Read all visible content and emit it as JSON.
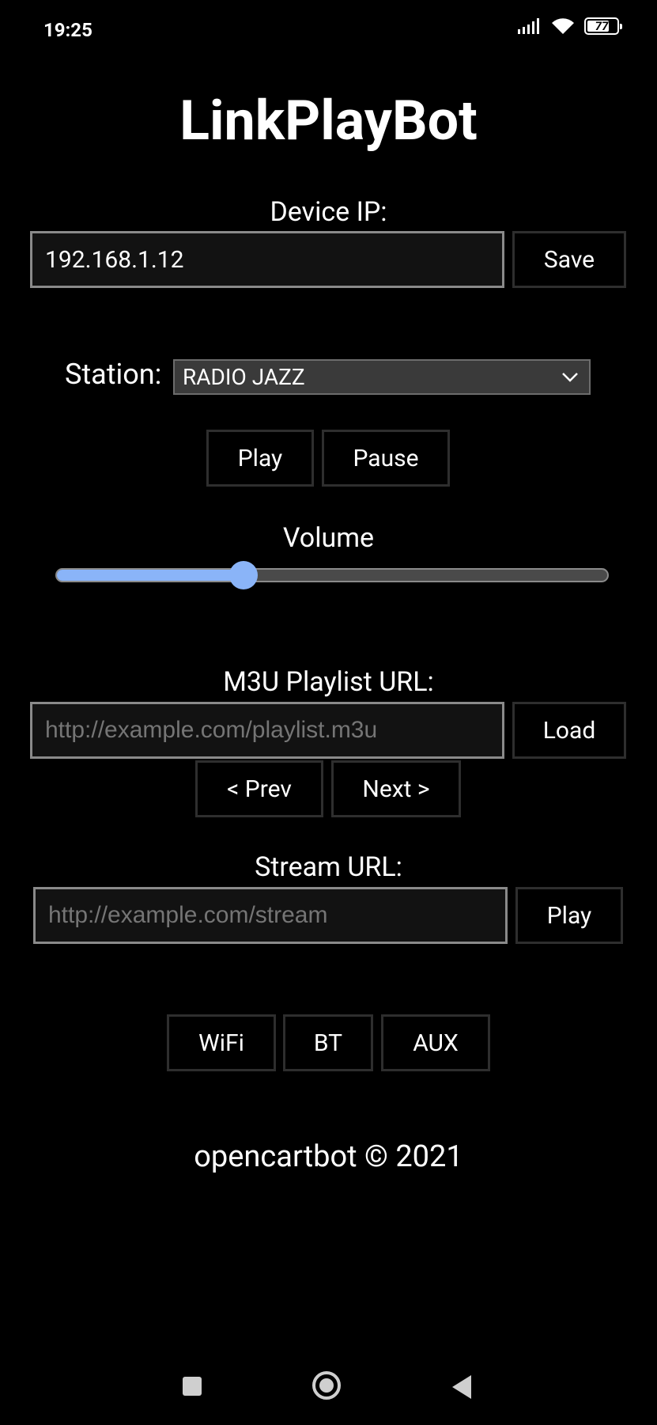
{
  "status_bar": {
    "time": "19:25",
    "battery": "77",
    "battery_level": 0.77
  },
  "app": {
    "title": "LinkPlayBot"
  },
  "device": {
    "label": "Device IP:",
    "value": "192.168.1.12",
    "save_label": "Save"
  },
  "station": {
    "label": "Station:",
    "selected": "RADIO JAZZ",
    "play_label": "Play",
    "pause_label": "Pause"
  },
  "volume": {
    "label": "Volume",
    "level": 0.34
  },
  "playlist": {
    "label": "M3U Playlist URL:",
    "placeholder": "http://example.com/playlist.m3u",
    "load_label": "Load",
    "prev_label": "< Prev",
    "next_label": "Next >"
  },
  "stream": {
    "label": "Stream URL:",
    "placeholder": "http://example.com/stream",
    "play_label": "Play"
  },
  "sources": {
    "wifi_label": "WiFi",
    "bt_label": "BT",
    "aux_label": "AUX"
  },
  "footer": {
    "text": "opencartbot © 2021"
  },
  "colors": {
    "background": "#000000",
    "accent": "#8ab4f8"
  }
}
